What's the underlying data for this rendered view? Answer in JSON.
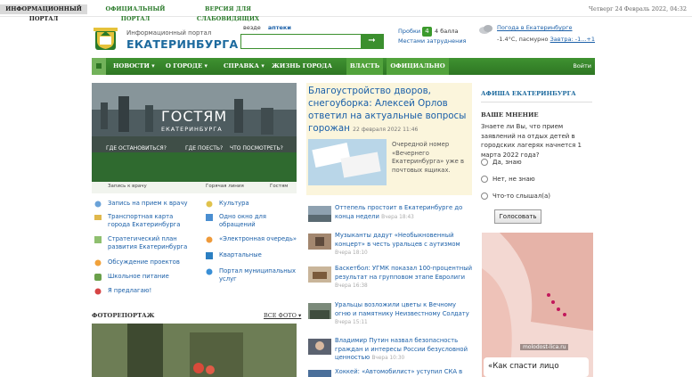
{
  "top": {
    "tabs": [
      "ИНФОРМАЦИОННЫЙ ПОРТАЛ",
      "ОФИЦИАЛЬНЫЙ ПОРТАЛ",
      "ВЕРСИЯ ДЛЯ СЛАБОВИДЯЩИХ"
    ],
    "datetime": "Четверг 24 Февраль 2022, 04:32"
  },
  "header": {
    "logo_sub": "Информационный портал",
    "logo_main": "ЕКАТЕРИНБУРГА",
    "search_tab_all": "везде",
    "search_tab_pharmacy": "аптеки",
    "search_value": "",
    "search_button_icon": "arrow-right-icon",
    "traffic_label": "Пробки",
    "traffic_level": "4",
    "traffic_score": "4 балла",
    "traffic_link": "Местами затруднения",
    "weather_title": "Погода в Екатеринбурге",
    "weather_now": "-1.4°C, пасмурно",
    "weather_tomorrow": "Завтра: -1...+1"
  },
  "nav": {
    "items": [
      "НОВОСТИ",
      "О ГОРОДЕ",
      "СПРАВКА",
      "ЖИЗНЬ ГОРОДА",
      "ВЛАСТЬ",
      "ОФИЦИАЛЬНО"
    ],
    "login": "Войти"
  },
  "banner": {
    "title": "ГОСТЯМ",
    "subtitle": "ЕКАТЕРИНБУРГА",
    "q1": "ГДЕ ОСТАНОВИТЬСЯ?",
    "q2": "ГДЕ ПОЕСТЬ?",
    "q3": "ЧТО ПОСМОТРЕТЬ?",
    "links": [
      "Запись к врачу",
      "Горячая линия",
      "Гостям"
    ]
  },
  "services_left": [
    "Запись на прием к врачу",
    "Транспортная карта города Екатеринбурга",
    "Стратегический план развития Екатеринбурга",
    "Обсуждение проектов",
    "Школьное питание",
    "Я предлагаю!"
  ],
  "services_right": [
    "Культура",
    "Одно окно для обращений",
    "«Электронная очередь»",
    "Квартальные",
    "Портал муниципальных услуг"
  ],
  "photo": {
    "title": "ФОТОРЕПОРТАЖ",
    "all": "ВСЕ ФОТО"
  },
  "feature": {
    "title": "Благоустройство дворов, снегоуборка: Алексей Орлов ответил на актуальные вопросы горожан",
    "date": "22 февраля 2022 11:46",
    "text": "Очередной номер «Вечернего Екатеринбурга» уже в почтовых ящиках."
  },
  "news": [
    {
      "title": "Оттепель простоит в Екатеринбурге до конца недели",
      "time": "Вчера 18:43"
    },
    {
      "title": "Музыканты дадут «Необыкновенный концерт» в честь уральцев с аутизмом",
      "time": "Вчера 18:10"
    },
    {
      "title": "Баскетбол: УГМК показал 100-процентный результат на групповом этапе Евролиги",
      "time": "Вчера 16:38"
    },
    {
      "title": "Уральцы возложили цветы к Вечному огню и памятнику Неизвестному Солдату",
      "time": "Вчера 15:11"
    },
    {
      "title": "Владимир Путин назвал безопасность граждан и интересы России безусловной ценностью",
      "time": "Вчера 10:30"
    },
    {
      "title": "Хоккей: «Автомобилист» уступил СКА в",
      "time": ""
    }
  ],
  "right": {
    "afisha": "АФИША ЕКАТЕРИНБУРГА",
    "opinion": "ВАШЕ МНЕНИЕ",
    "question": "Знаете ли Вы, что прием заявлений на отдых детей в городских лагерях начнется 1 марта 2022 года?",
    "options": [
      "Да, знаю",
      "Нет, не знаю",
      "Что-то слышал(а)"
    ],
    "vote": "Голосовать",
    "ad_site": "molodost-lica.ru",
    "ad_caption": "«Как спасти лицо"
  }
}
